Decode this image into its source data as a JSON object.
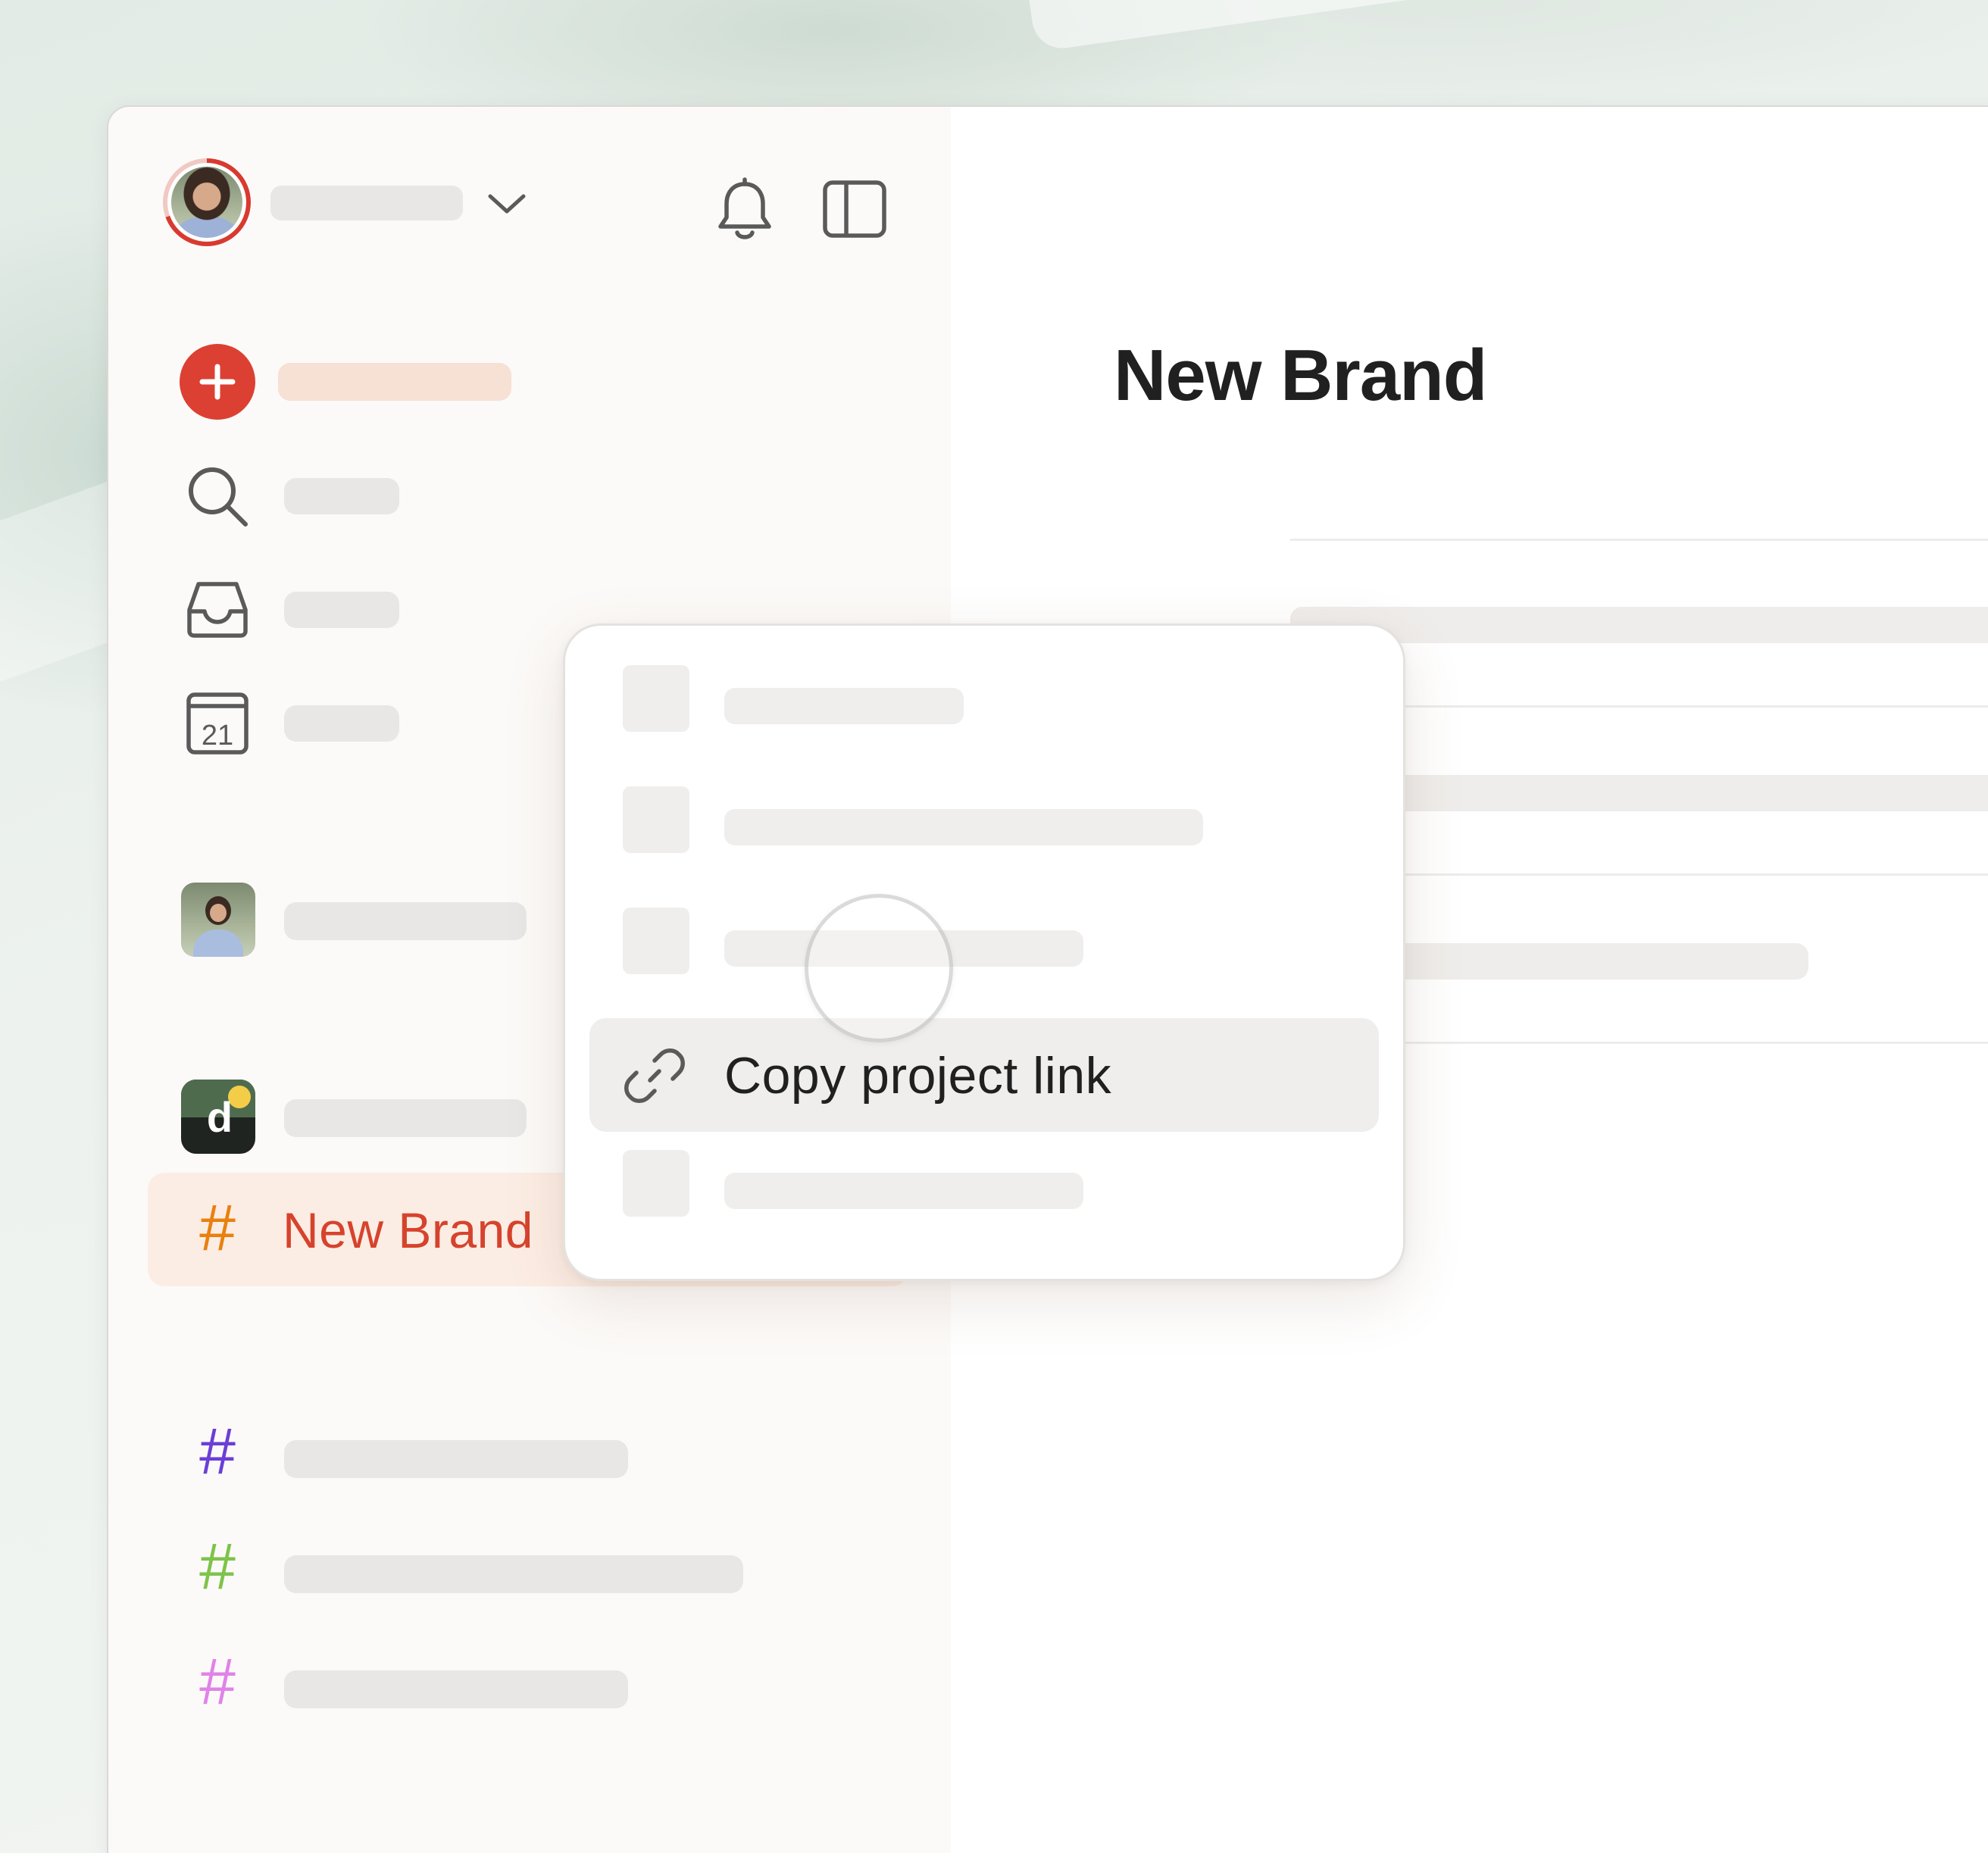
{
  "project": {
    "title": "New Brand"
  },
  "sidebar": {
    "active_project": {
      "label": "New Brand",
      "icon": "hash-icon",
      "color": "#e9800f"
    },
    "projects": [
      {
        "icon": "hash-icon",
        "color": "#e9800f"
      },
      {
        "icon": "hash-icon",
        "color": "#6b3fd6"
      },
      {
        "icon": "hash-icon",
        "color": "#7ec34a"
      },
      {
        "icon": "hash-icon",
        "color": "#e083e8"
      }
    ],
    "nav_icons": [
      "add-task-icon",
      "search-icon",
      "inbox-icon",
      "calendar-icon"
    ],
    "calendar_day": "21"
  },
  "context_menu": {
    "highlighted_item": {
      "label": "Copy project link",
      "icon": "link-icon"
    }
  },
  "colors": {
    "accent": "#dc4033",
    "active_bg": "#fcede4",
    "active_text": "#d6432d"
  }
}
